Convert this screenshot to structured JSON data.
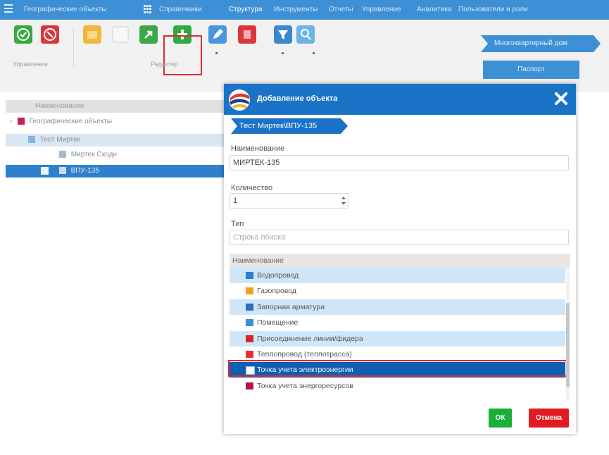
{
  "menu": {
    "items": [
      "Географические объекты",
      "Справочники",
      "Структура",
      "Инструменты",
      "Отчеты",
      "Управление",
      "Аналитика",
      "Пользователи и роли"
    ],
    "active": "Структура"
  },
  "toolbar": {
    "group_management": "Управление",
    "group_edit": "Редактир"
  },
  "right_panel": {
    "breadcrumb": "Многоквартирный дом",
    "passport_button": "Паспорт"
  },
  "tree": {
    "header": "Наименование",
    "rows": [
      {
        "label": "Географические объекты",
        "level": 0
      },
      {
        "label": "Тест Миртек",
        "level": 1
      },
      {
        "label": "Миртек Сходн",
        "level": 2
      },
      {
        "label": "ВПУ-135",
        "level": 3
      }
    ]
  },
  "dialog": {
    "title": "Добавление объекта",
    "breadcrumb": "Тест Миртек\\ВПУ-135",
    "name_label": "Наименование",
    "name_value": "МИРТЕК-135",
    "qty_label": "Количество",
    "qty_value": "1",
    "type_label": "Тип",
    "search_placeholder": "Строка поиска",
    "list_header": "Наименование",
    "items": [
      {
        "label": "Водопровод",
        "icon": "water-pipe-icon",
        "color": "#2a7fd4"
      },
      {
        "label": "Газопровод",
        "icon": "gas-pipe-icon",
        "color": "#f0a020"
      },
      {
        "label": "Запорная арматура",
        "icon": "valve-icon",
        "color": "#2a6fb8"
      },
      {
        "label": "Помещение",
        "icon": "room-icon",
        "color": "#3a8fd8"
      },
      {
        "label": "Присоединение линии/фидера",
        "icon": "feeder-icon",
        "color": "#d9232a"
      },
      {
        "label": "Теплопровод (теплотрасса)",
        "icon": "heat-pipe-icon",
        "color": "#e0302a"
      },
      {
        "label": "Точка учета электроэнергии",
        "icon": "electric-meter-icon",
        "color": "#ffffff"
      },
      {
        "label": "Точка учета энергоресурсов",
        "icon": "energy-meter-icon",
        "color": "#b0144f"
      }
    ],
    "selected_index": 6,
    "ok_label": "ОК",
    "cancel_label": "Отмена"
  },
  "colors": {
    "accent": "#1a73c7",
    "highlight": "#e02a2a",
    "ok": "#1cae39",
    "cancel": "#e21b22"
  }
}
